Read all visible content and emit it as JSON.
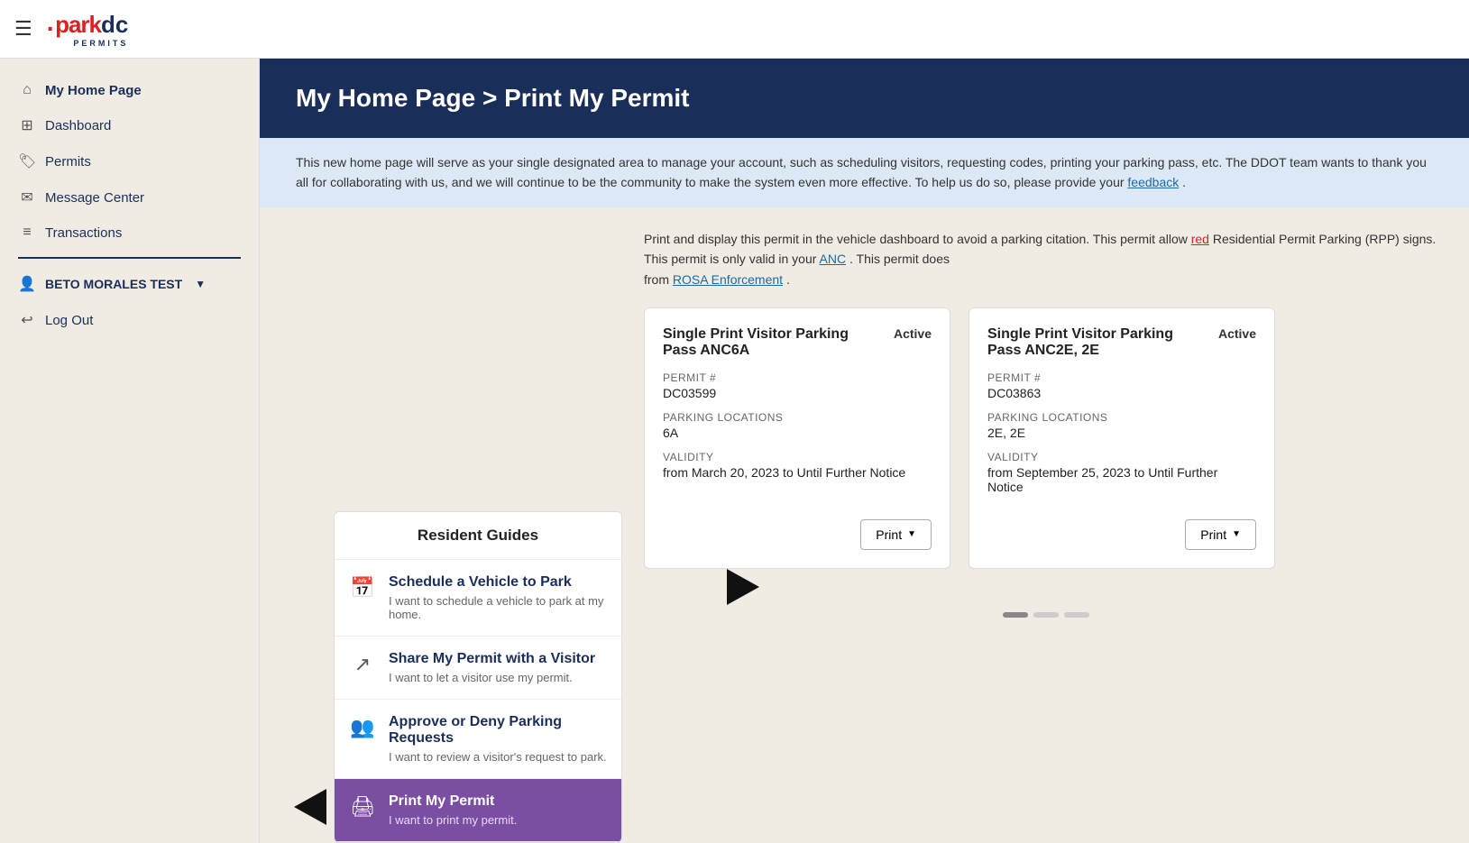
{
  "topnav": {
    "logo_dot": "·",
    "logo_park": "park",
    "logo_dc": "dc",
    "logo_permits": "PERMITS"
  },
  "sidebar": {
    "items": [
      {
        "id": "home",
        "label": "My Home Page",
        "icon": "⌂"
      },
      {
        "id": "dashboard",
        "label": "Dashboard",
        "icon": "⊞"
      },
      {
        "id": "permits",
        "label": "Permits",
        "icon": "🏷"
      },
      {
        "id": "messages",
        "label": "Message Center",
        "icon": "✉"
      },
      {
        "id": "transactions",
        "label": "Transactions",
        "icon": "≡"
      }
    ],
    "user": {
      "name": "BETO MORALES TEST"
    },
    "logout_label": "Log Out"
  },
  "header": {
    "breadcrumb": "My Home Page > Print My Permit"
  },
  "info_banner": {
    "text_part1": "This new home page will serve as your single designated area to manage your account, such as scheduling visitors, requesting ",
    "text_part2": "codes, printing your parking pass, etc. The DDOT team wants to thank you all for collaborating with us, and we will continue to be",
    "text_part3": " the community to make the system even more effective. To help us do so, please provide your ",
    "feedback_link": "feedback",
    "text_end": "."
  },
  "permits_description": {
    "text1": "Print and display this permit in the vehicle dashboard to avoid a parking citation. This permit allow",
    "link1_color": "red",
    "link1": "red",
    "text2": " Residential Permit Parking (RPP) signs. This permit is only valid in your ",
    "link2": "ANC",
    "text3": ". This permit does",
    "link3": "ROSA Enforcement",
    "text4": " from "
  },
  "guides": {
    "header": "Resident Guides",
    "items": [
      {
        "id": "schedule",
        "icon": "📅",
        "title": "Schedule a Vehicle to Park",
        "desc": "I want to schedule a vehicle to park at my home."
      },
      {
        "id": "share",
        "icon": "↗",
        "title": "Share My Permit with a Visitor",
        "desc": "I want to let a visitor use my permit."
      },
      {
        "id": "approve",
        "icon": "👥",
        "title": "Approve or Deny Parking Requests",
        "desc": "I want to review a visitor's request to park."
      },
      {
        "id": "print",
        "icon": "🖨",
        "title": "Print My Permit",
        "desc": "I want to print my permit.",
        "active": true
      }
    ]
  },
  "permit_cards": [
    {
      "id": "card1",
      "name": "Single Print Visitor Parking Pass ANC6A",
      "status": "Active",
      "permit_label": "PERMIT #",
      "permit_number": "DC03599",
      "locations_label": "Parking Locations",
      "locations_value": "6A",
      "validity_label": "Validity",
      "validity_value": "from March 20, 2023 to Until Further Notice",
      "print_label": "Print"
    },
    {
      "id": "card2",
      "name": "Single Print Visitor Parking Pass ANC2E, 2E",
      "status": "Active",
      "permit_label": "PERMIT #",
      "permit_number": "DC03863",
      "locations_label": "Parking Locations",
      "locations_value": "2E, 2E",
      "validity_label": "Validity",
      "validity_value": "from September 25, 2023 to Until Further Notice",
      "print_label": "Print"
    }
  ],
  "arrows": {
    "left_arrow_label": "→",
    "right_arrow_label": "←"
  }
}
